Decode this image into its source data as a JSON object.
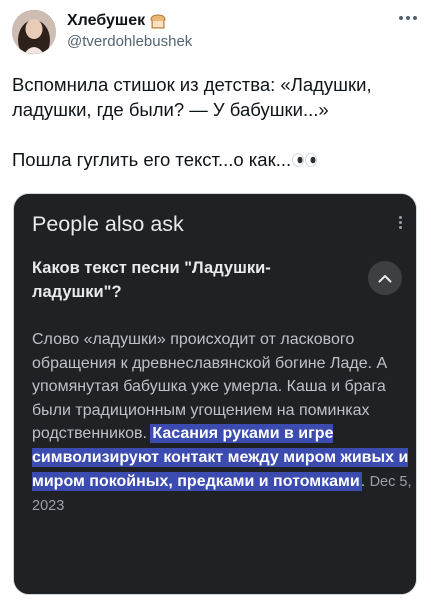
{
  "user": {
    "display_name": "Хлебушек",
    "handle": "@tverdohlebushek"
  },
  "tweet": {
    "line1": "Вспомнила стишок из детства: «Ладушки, ладушки, где были? — У бабушки...»",
    "line2": "Пошла гуглить его текст...о как..."
  },
  "card": {
    "section_title": "People also ask",
    "question": "Каков текст песни \"Ладушки-ладушки\"?",
    "answer_plain": "Слово «ладушки» происходит от ласкового обращения к древнеславянской богине Ладе. А упомянутая бабушка уже умерла. Каша и брага были традиционным угощением на поминках родственников. ",
    "answer_highlight": "Касания руками в игре символизируют контакт между миром живых и миром покойных, предками и потомками",
    "answer_tail": ". ",
    "date": "Dec 5, 2023"
  },
  "icons": {
    "bread": "bread-icon",
    "more": "more-icon",
    "eyes": "eyes-emoji",
    "kebab": "kebab-icon",
    "chevron": "chevron-up-icon"
  },
  "colors": {
    "card_bg": "#202124",
    "highlight": "#3c4bb0"
  }
}
